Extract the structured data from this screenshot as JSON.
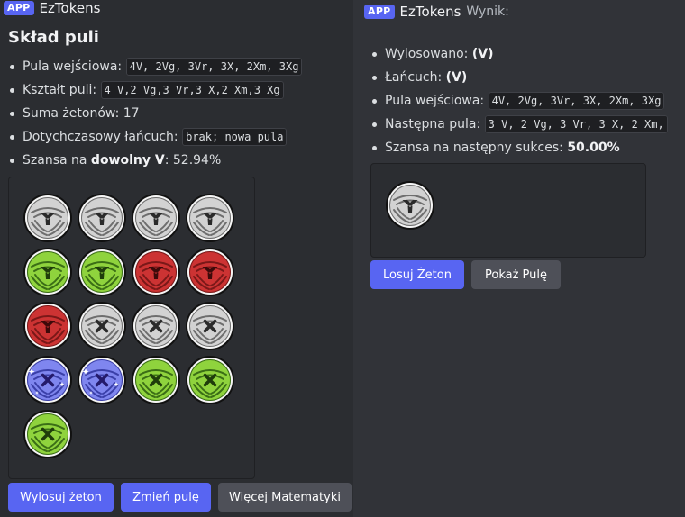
{
  "app_badge": "APP",
  "left": {
    "bot_name": "EzTokens",
    "title": "Skład puli",
    "facts": [
      {
        "label": "Pula wejściowa:",
        "code": "4V, 2Vg, 3Vr, 3X, 2Xm, 3Xg"
      },
      {
        "label": "Kształt puli:",
        "code": "4 V,2 Vg,3 Vr,3 X,2 Xm,3 Xg"
      },
      {
        "label": "Suma żetonów: 17"
      },
      {
        "label": "Dotychczasowy łańcuch:",
        "code": "brak; nowa pula"
      },
      {
        "label": "Szansa na ",
        "bold": "dowolny V",
        "suffix": ": 52.94%"
      }
    ],
    "tokens": [
      "V",
      "V",
      "V",
      "V",
      "Vg",
      "Vg",
      "Vr",
      "Vr",
      "Vr",
      "X",
      "X",
      "X",
      "Xm",
      "Xm",
      "Xg",
      "Xg",
      "Xg"
    ],
    "buttons": {
      "draw": "Wylosuj żeton",
      "change": "Zmień pulę",
      "more": "Więcej Matematyki"
    }
  },
  "right": {
    "bot_name": "EzTokens",
    "status": "Wynik:",
    "facts": [
      {
        "label": "Wylosowano: ",
        "bold": "(V)"
      },
      {
        "label": "Łańcuch: ",
        "bold": "(V)"
      },
      {
        "label": "Pula wejściowa:",
        "code": "4V, 2Vg, 3Vr, 3X, 2Xm, 3Xg"
      },
      {
        "label": "Następna pula:",
        "code": "3 V, 2 Vg, 3 Vr, 3 X, 2 Xm,"
      },
      {
        "label": "Szansa na następny sukces: ",
        "bold": "50.00%"
      }
    ],
    "tokens": [
      "V"
    ],
    "buttons": {
      "draw": "Losuj Żeton",
      "show": "Pokaż Pulę"
    }
  },
  "colors": {
    "plain": "#d2d2d2",
    "green": "#8fd33d",
    "red": "#cc3333",
    "blue": "#7f86ef",
    "accent": "#5865f2"
  },
  "icons": {
    "V": "y-chevron-icon",
    "X": "x-cross-icon",
    "sparkle": "sparkle-icon"
  }
}
